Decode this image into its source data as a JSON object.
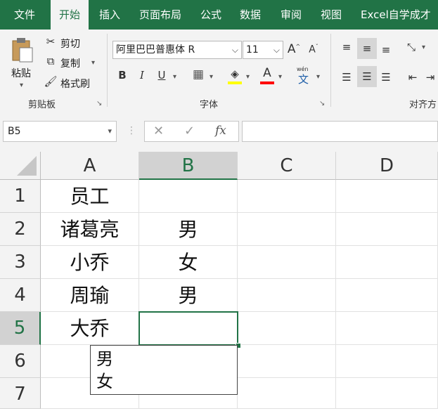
{
  "ribbon_tabs": [
    "文件",
    "开始",
    "插入",
    "页面布局",
    "公式",
    "数据",
    "审阅",
    "视图",
    "Excel自学成才"
  ],
  "active_tab": "开始",
  "clipboard": {
    "paste_label": "粘贴",
    "cut_label": "剪切",
    "copy_label": "复制",
    "format_painter_label": "格式刷",
    "group_label": "剪贴板"
  },
  "font": {
    "font_name": "阿里巴巴普惠体 R",
    "font_size": "11",
    "bold": "B",
    "italic": "I",
    "underline": "U",
    "grow": "A",
    "shrink": "A",
    "font_color_letter": "A",
    "phonetic": "文",
    "phonetic_top": "wén",
    "group_label": "字体"
  },
  "alignment": {
    "group_label": "对齐方"
  },
  "formula_bar": {
    "name_box": "B5",
    "cancel": "✕",
    "enter": "✓",
    "fx": "fx",
    "formula": ""
  },
  "columns": [
    "A",
    "B",
    "C",
    "D"
  ],
  "rows": [
    "1",
    "2",
    "3",
    "4",
    "5",
    "6",
    "7"
  ],
  "cells": {
    "A1": "员工",
    "A2": "诸葛亮",
    "A3": "小乔",
    "A4": "周瑜",
    "A5": "大乔",
    "B2": "男",
    "B3": "女",
    "B4": "男"
  },
  "selected_cell": "B5",
  "dropdown_options": [
    "男",
    "女"
  ],
  "colors": {
    "accent": "#217346",
    "fill_highlight": "#ffff00",
    "font_red": "#ff0000"
  }
}
